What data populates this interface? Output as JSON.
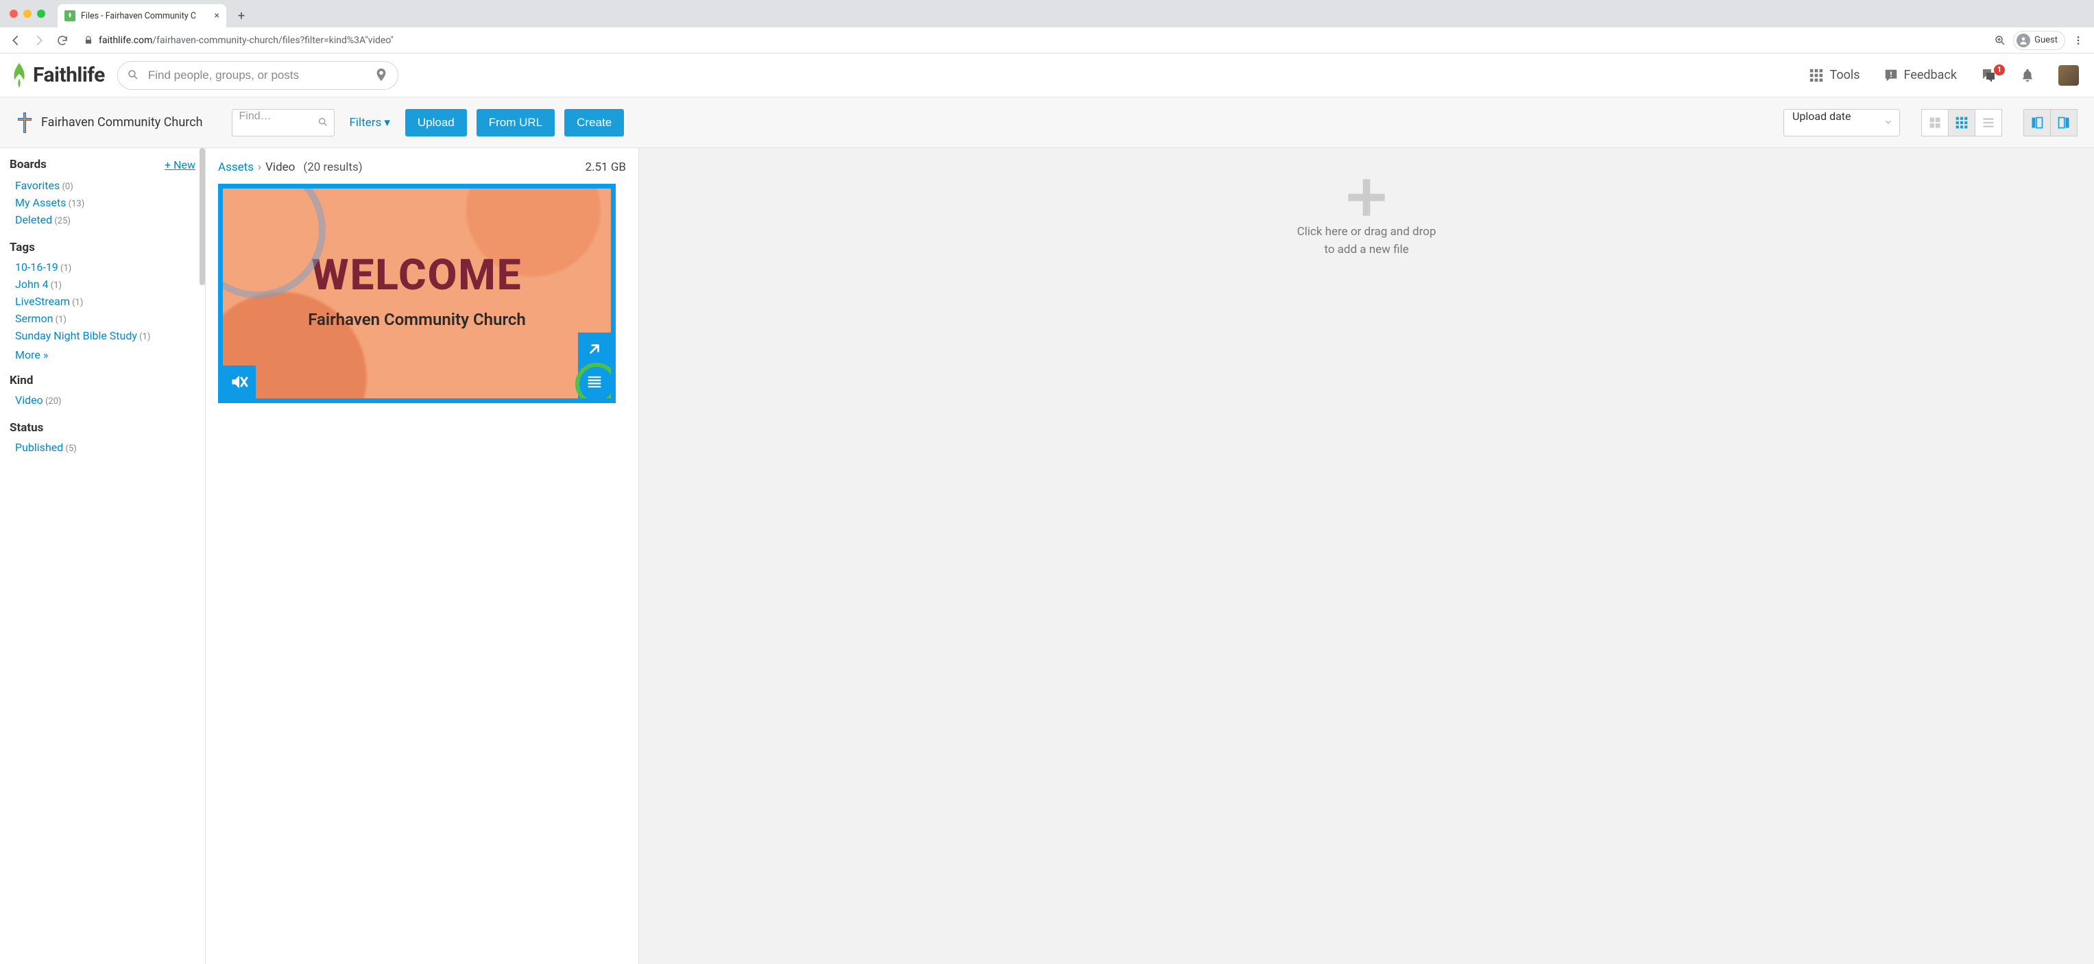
{
  "browser": {
    "tab_title": "Files - Fairhaven Community C",
    "url_display_host": "faithlife.com",
    "url_display_path": "/fairhaven-community-church/files?filter=kind%3A\"video\"",
    "guest_label": "Guest"
  },
  "header": {
    "logo_text": "Faithlife",
    "search_placeholder": "Find people, groups, or posts",
    "tools_label": "Tools",
    "feedback_label": "Feedback",
    "message_badge": "1"
  },
  "toolbar": {
    "group_name": "Fairhaven Community Church",
    "find_placeholder": "Find…",
    "filters_label": "Filters",
    "upload_label": "Upload",
    "from_url_label": "From URL",
    "create_label": "Create",
    "sort_label": "Upload date"
  },
  "sidebar": {
    "boards_heading": "Boards",
    "new_label": "+ New",
    "boards": [
      {
        "label": "Favorites",
        "count": "(0)"
      },
      {
        "label": "My Assets",
        "count": "(13)"
      },
      {
        "label": "Deleted",
        "count": "(25)"
      }
    ],
    "tags_heading": "Tags",
    "tags": [
      {
        "label": "10-16-19",
        "count": "(1)"
      },
      {
        "label": "John 4",
        "count": "(1)"
      },
      {
        "label": "LiveStream",
        "count": "(1)"
      },
      {
        "label": "Sermon",
        "count": "(1)"
      },
      {
        "label": "Sunday Night Bible Study",
        "count": "(1)"
      }
    ],
    "more_label": "More »",
    "kind_heading": "Kind",
    "kinds": [
      {
        "label": "Video",
        "count": "(20)"
      }
    ],
    "status_heading": "Status",
    "statuses": [
      {
        "label": "Published",
        "count": "(5)"
      }
    ]
  },
  "content": {
    "crumb_root": "Assets",
    "crumb_current": "Video",
    "results_text": "(20 results)",
    "total_size": "2.51 GB",
    "card_title": "WELCOME",
    "card_subtitle": "Fairhaven Community Church"
  },
  "right_pane": {
    "drop_line1": "Click here or drag and drop",
    "drop_line2": "to add a new file"
  }
}
